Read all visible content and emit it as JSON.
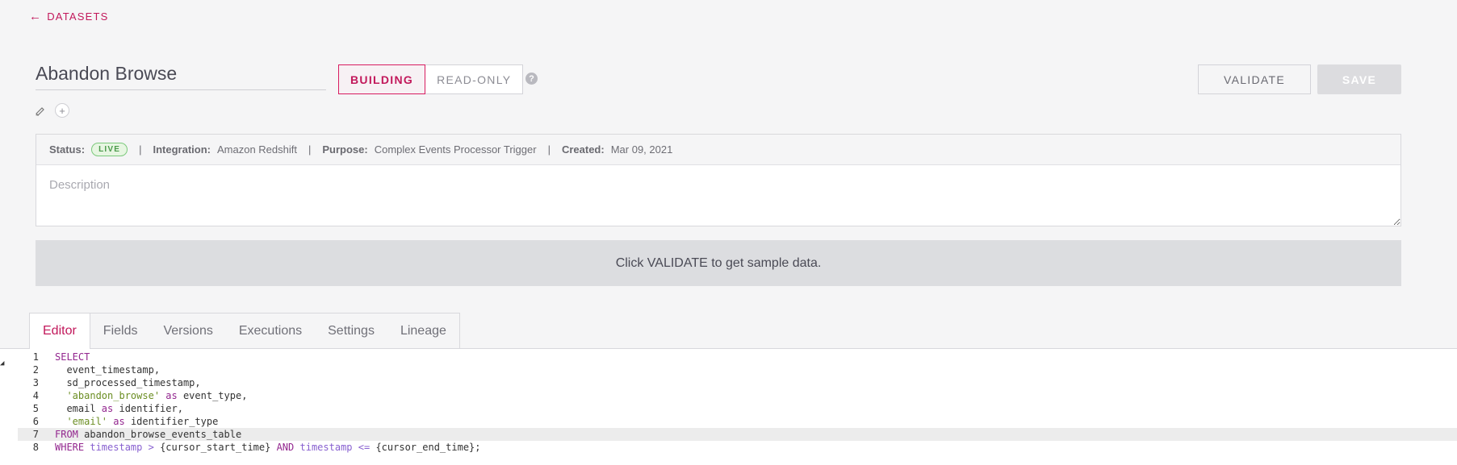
{
  "nav": {
    "back_label": "DATASETS",
    "back_arrow": "←"
  },
  "dataset": {
    "title": "Abandon Browse"
  },
  "mode": {
    "building": "BUILDING",
    "read_only": "READ-ONLY",
    "help": "?"
  },
  "actions": {
    "validate": "VALIDATE",
    "save": "SAVE"
  },
  "tools": {
    "add": "+"
  },
  "meta": {
    "status_label": "Status:",
    "status_value": "LIVE",
    "integration_label": "Integration:",
    "integration_value": "Amazon Redshift",
    "purpose_label": "Purpose:",
    "purpose_value": "Complex Events Processor Trigger",
    "created_label": "Created:",
    "created_value": "Mar 09, 2021",
    "separator": "|"
  },
  "description": {
    "placeholder": "Description"
  },
  "sample": {
    "message": "Click VALIDATE to get sample data."
  },
  "tabs": [
    "Editor",
    "Fields",
    "Versions",
    "Executions",
    "Settings",
    "Lineage"
  ],
  "editor": {
    "active_line": 7,
    "line_numbers": [
      "1",
      "2",
      "3",
      "4",
      "5",
      "6",
      "7",
      "8"
    ]
  },
  "colors": {
    "accent": "#c2185b",
    "live_green": "#4b9a4b",
    "keyword": "#93278f",
    "string": "#6b8e23"
  }
}
